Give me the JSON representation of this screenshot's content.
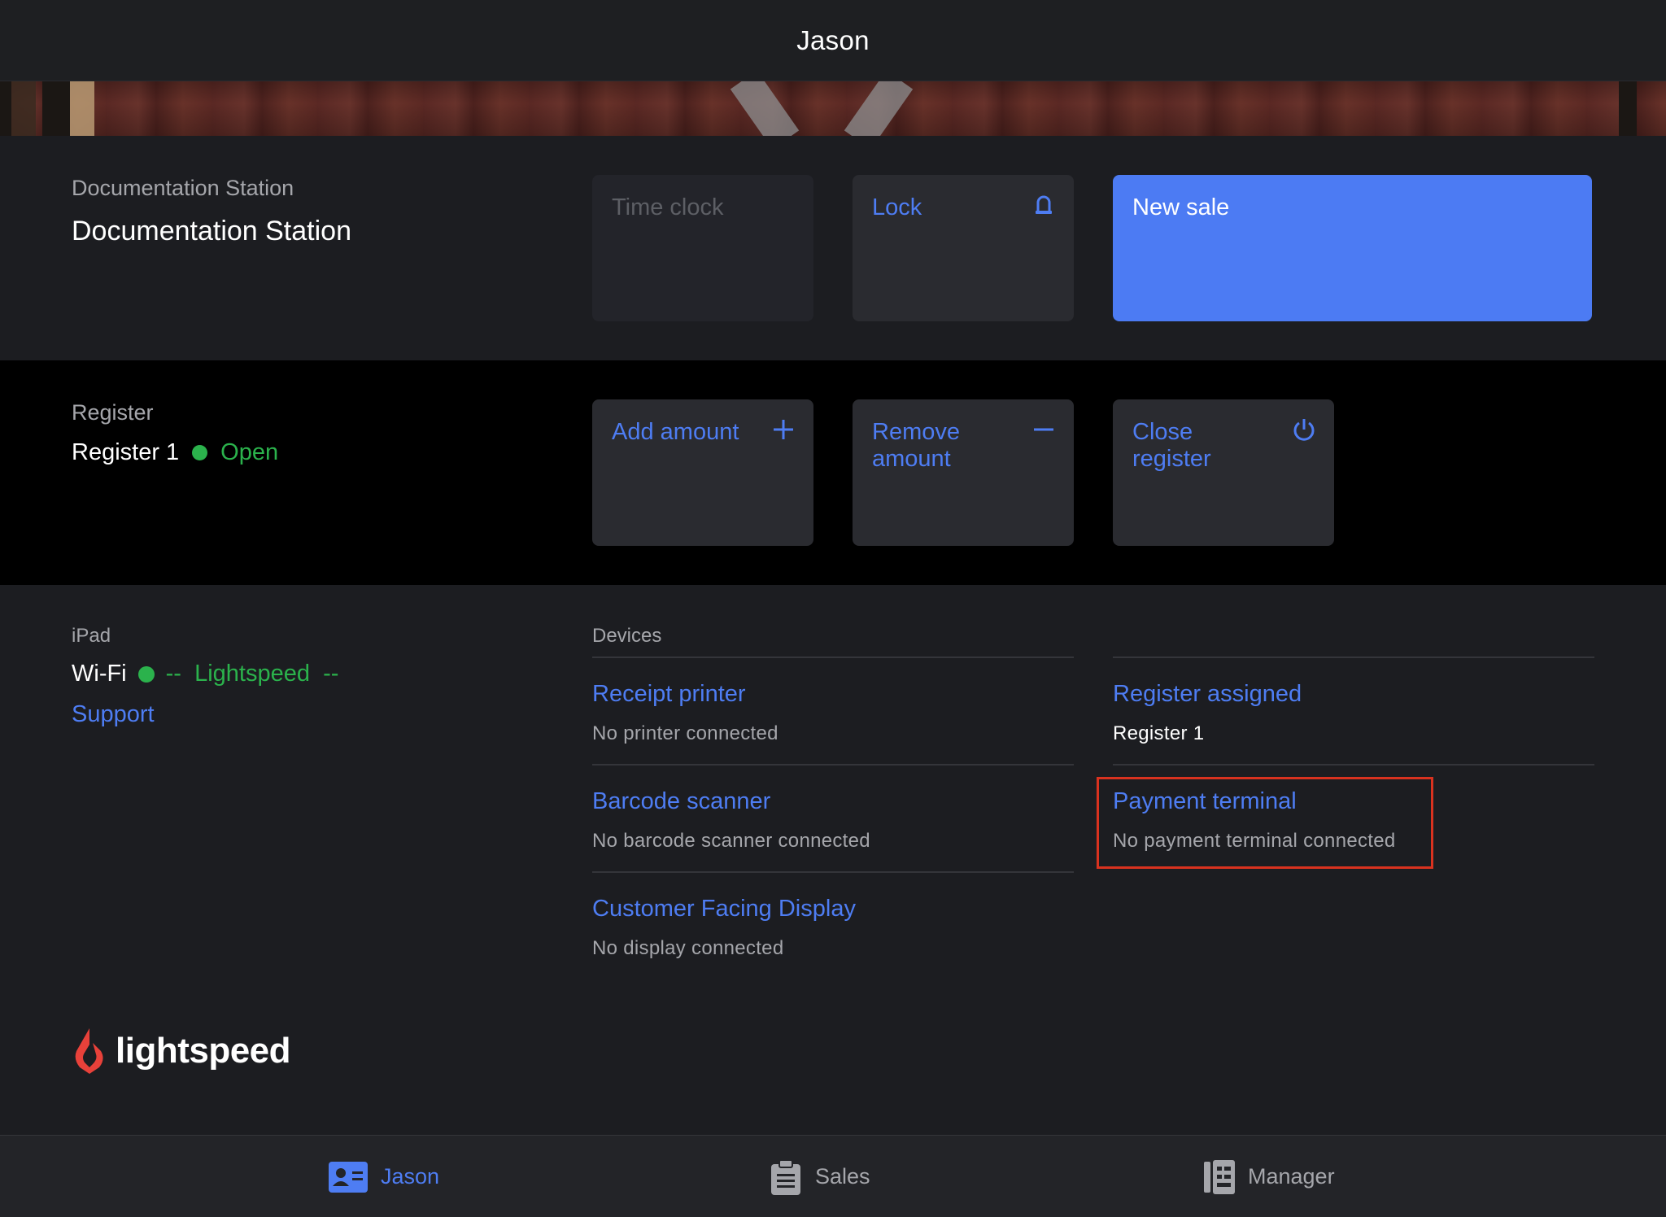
{
  "header": {
    "title": "Jason"
  },
  "station": {
    "section_label": "Documentation Station",
    "name": "Documentation Station",
    "tiles": {
      "time_clock": "Time clock",
      "lock": "Lock",
      "new_sale": "New sale"
    }
  },
  "register": {
    "section_label": "Register",
    "name": "Register 1",
    "status": "Open",
    "status_color": "#2bb24c",
    "tiles": {
      "add_amount": "Add amount",
      "remove_amount": "Remove amount",
      "close_register": "Close register"
    }
  },
  "ipad": {
    "section_label": "iPad",
    "wifi_label": "Wi-Fi",
    "wifi_network": "--  Lightspeed  --",
    "support_link": "Support"
  },
  "devices": {
    "heading": "Devices",
    "items": [
      {
        "name": "Receipt printer",
        "status": "No printer connected"
      },
      {
        "name": "Barcode scanner",
        "status": "No barcode scanner connected"
      },
      {
        "name": "Customer Facing Display",
        "status": "No display connected"
      },
      {
        "name": "Register assigned",
        "status": "Register 1"
      },
      {
        "name": "Payment terminal",
        "status": "No payment terminal connected"
      }
    ]
  },
  "brand": {
    "logo_text": "lightspeed",
    "accent": "#4e7df3",
    "logo_color": "#e8413a"
  },
  "tabbar": {
    "tabs": [
      {
        "label": "Jason",
        "icon": "user-card-icon",
        "active": true
      },
      {
        "label": "Sales",
        "icon": "clipboard-icon",
        "active": false
      },
      {
        "label": "Manager",
        "icon": "binder-icon",
        "active": false
      }
    ]
  }
}
